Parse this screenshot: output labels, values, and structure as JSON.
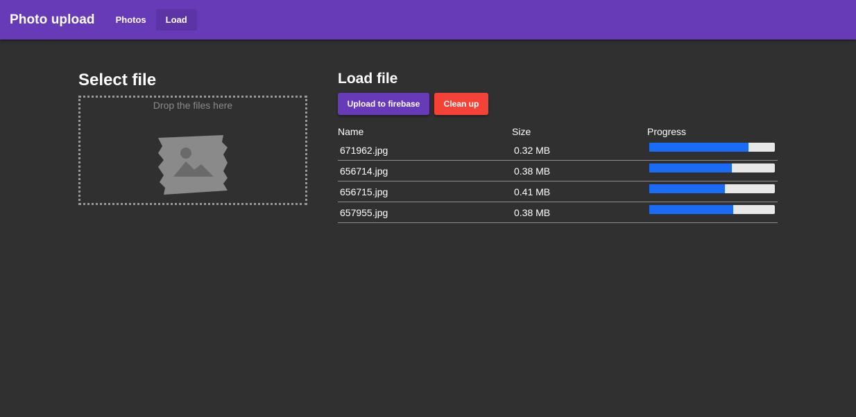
{
  "header": {
    "title": "Photo upload",
    "nav": [
      {
        "label": "Photos",
        "active": false
      },
      {
        "label": "Load",
        "active": true
      }
    ]
  },
  "select_section": {
    "title": "Select file",
    "drop_text": "Drop the files here",
    "placeholder_icon": "image-placeholder-icon"
  },
  "load_section": {
    "title": "Load file",
    "upload_button": "Upload to firebase",
    "cleanup_button": "Clean up",
    "columns": [
      "Name",
      "Size",
      "Progress"
    ],
    "files": [
      {
        "name": "671962.jpg",
        "size": "0.32 MB",
        "progress": 0.79
      },
      {
        "name": "656714.jpg",
        "size": "0.38 MB",
        "progress": 0.66
      },
      {
        "name": "656715.jpg",
        "size": "0.41 MB",
        "progress": 0.6
      },
      {
        "name": "657955.jpg",
        "size": "0.38 MB",
        "progress": 0.67
      }
    ]
  },
  "colors": {
    "primary": "#673ab7",
    "warn": "#f44336",
    "progress": "#1a6bf5",
    "background": "#303030"
  }
}
